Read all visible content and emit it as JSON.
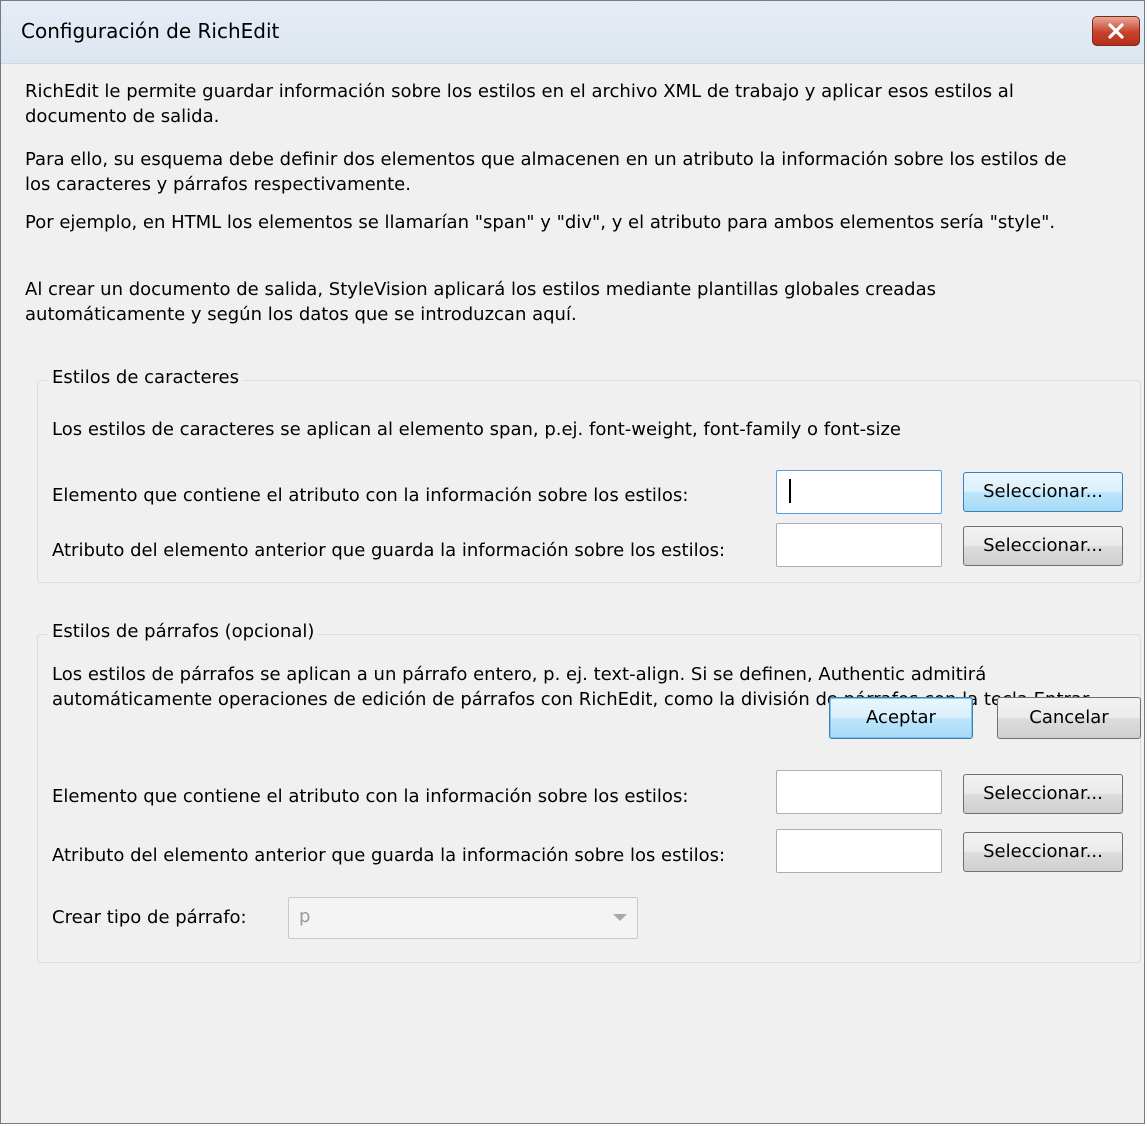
{
  "window": {
    "title": "Configuración de RichEdit",
    "close_icon": "close-x-icon"
  },
  "intro": [
    "RichEdit le permite guardar información sobre los estilos en el archivo XML de trabajo y aplicar esos estilos al documento de salida.",
    "Para ello, su esquema debe definir dos elementos que almacenen en un atributo la información sobre los estilos de los caracteres y párrafos respectivamente.",
    "Por ejemplo, en HTML los elementos se llamarían \"span\" y \"div\", y el atributo para ambos elementos sería \"style\".",
    "Al crear un documento de salida, StyleVision aplicará los estilos mediante plantillas globales creadas automáticamente y según los datos que se introduzcan aquí."
  ],
  "char_styles": {
    "legend": "Estilos de caracteres",
    "description": "Los estilos de caracteres se aplican al elemento span, p.ej. font-weight, font-family o font-size",
    "element_label": "Elemento que contiene el atributo con la información sobre los estilos:",
    "element_value": "",
    "attribute_label": "Atributo del elemento anterior que guarda la información sobre los estilos:",
    "attribute_value": "",
    "select_label": "Seleccionar..."
  },
  "para_styles": {
    "legend": "Estilos de párrafos (opcional)",
    "description": "Los estilos de párrafos se aplican a un párrafo entero, p. ej. text-align. Si se definen, Authentic admitirá automáticamente operaciones de edición de párrafos con RichEdit, como la división de párrafos con la tecla Entrar.",
    "element_label": "Elemento que contiene el atributo con la información sobre los estilos:",
    "element_value": "",
    "attribute_label": "Atributo del elemento anterior que guarda la información sobre los estilos:",
    "attribute_value": "",
    "select_label": "Seleccionar...",
    "para_type_label": "Crear tipo de párrafo:",
    "para_type_value": "p"
  },
  "footer": {
    "ok_label": "Aceptar",
    "cancel_label": "Cancelar"
  }
}
